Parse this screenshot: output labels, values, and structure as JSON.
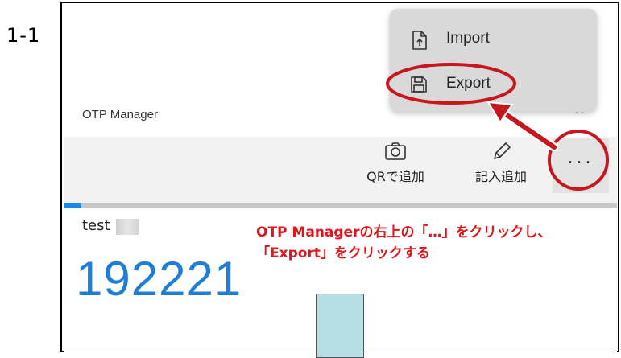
{
  "step_label": "1-1",
  "window": {
    "title": "OTP Manager",
    "close_glyph": "×"
  },
  "command_bar": {
    "qr_label": "QRで追加",
    "manual_label": "記入追加",
    "more_label": "...",
    "icons": {
      "qr": "camera-icon",
      "manual": "pencil-icon"
    }
  },
  "progress": {
    "fraction": 0.03,
    "fill_color": "#1e88e5"
  },
  "entry": {
    "account_name": "test",
    "otp_code": "192221"
  },
  "menu": {
    "items": [
      {
        "label": "Import",
        "icon": "import-file-icon"
      },
      {
        "label": "Export",
        "icon": "save-icon"
      }
    ]
  },
  "annotation": {
    "line1": "OTP Managerの右上の「…」をクリックし、",
    "line2": "「Export」をクリックする",
    "color": "#e0151c"
  }
}
